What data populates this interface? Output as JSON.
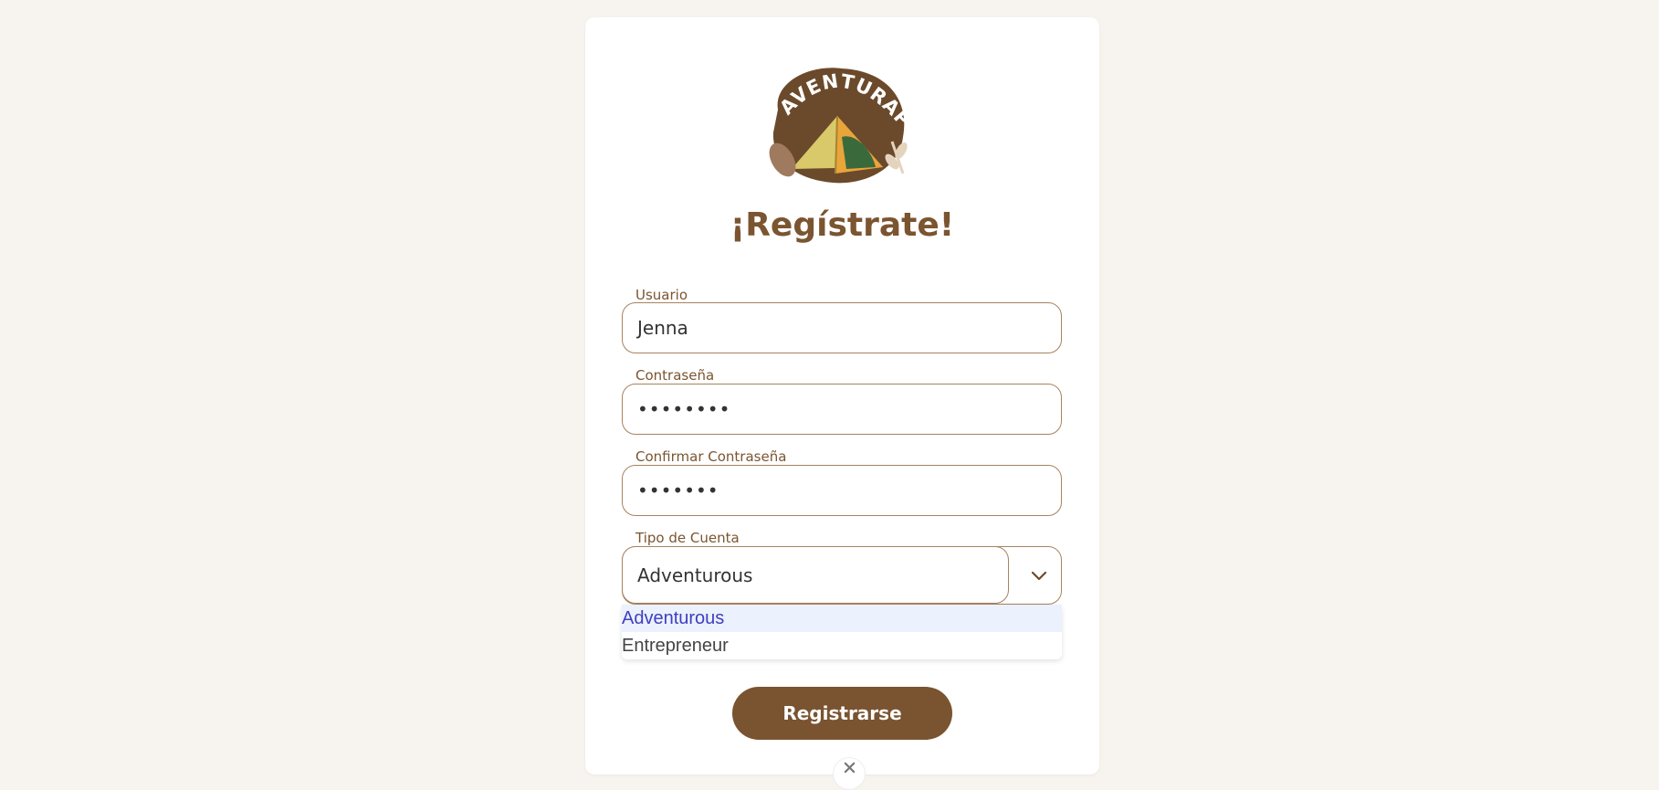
{
  "logo": {
    "text": "AVENTURAPE",
    "alt": "Aventurape logo"
  },
  "form": {
    "title": "¡Regístrate!",
    "username": {
      "label": "Usuario",
      "value": "Jenna"
    },
    "password": {
      "label": "Contraseña",
      "masked_value": "••••••••"
    },
    "confirm_password": {
      "label": "Confirmar Contraseña",
      "masked_value": "•••••••"
    },
    "account_type": {
      "label": "Tipo de Cuenta",
      "value": "Adventurous",
      "options": [
        "Adventurous",
        "Entrepreneur"
      ],
      "selected_index": 0
    },
    "submit_label": "Registrarse"
  },
  "colors": {
    "brand_brown": "#7a5330",
    "page_bg": "#f7f3ee",
    "input_border": "#a8825f",
    "option_highlight_bg": "#ebf1fd",
    "option_highlight_text": "#3f3fbf"
  },
  "icons": {
    "select_toggle": "chevron-down-icon",
    "close": "close-icon"
  }
}
